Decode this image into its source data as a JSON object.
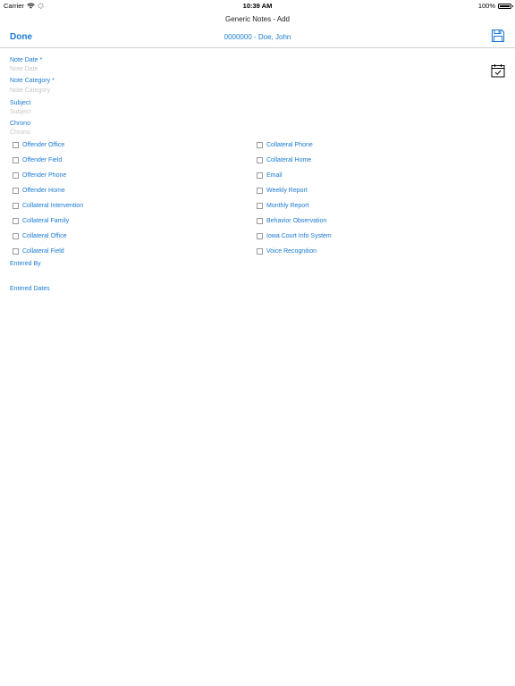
{
  "status_bar": {
    "carrier": "Carrier",
    "time": "10:39 AM",
    "battery": "100%"
  },
  "nav": {
    "title": "Generic Notes - Add",
    "done_label": "Done",
    "client": "0000000 - Doe, John"
  },
  "form": {
    "note_date": {
      "label": "Note Date *",
      "placeholder": "Note Date"
    },
    "note_category": {
      "label": "Note Category *",
      "placeholder": "Note Category"
    },
    "subject": {
      "label": "Subject",
      "placeholder": "Subject"
    },
    "chrono": {
      "label": "Chrono",
      "placeholder": "Chrono"
    },
    "left_options": [
      "Offender Office",
      "Offender Field",
      "Offender Phone",
      "Offender Home",
      "Collateral Intervention",
      "Collateral Family",
      "Collateral Office",
      "Collateral Field"
    ],
    "right_options": [
      "Collateral Phone",
      "Collateral Home",
      "Email",
      "Weekly Report",
      "Monthly Report",
      "Behavior Observation",
      "Iowa Court Info System",
      "Voice Recognition"
    ],
    "entered_by_label": "Entered By",
    "entered_dates_label": "Entered Dates"
  },
  "colors": {
    "accent": "#1a7ad3",
    "placeholder": "#c8c8c8"
  },
  "icons": {
    "save": "floppy-disk-icon",
    "calendar": "calendar-check-icon",
    "wifi": "wifi-icon",
    "battery": "battery-icon"
  }
}
